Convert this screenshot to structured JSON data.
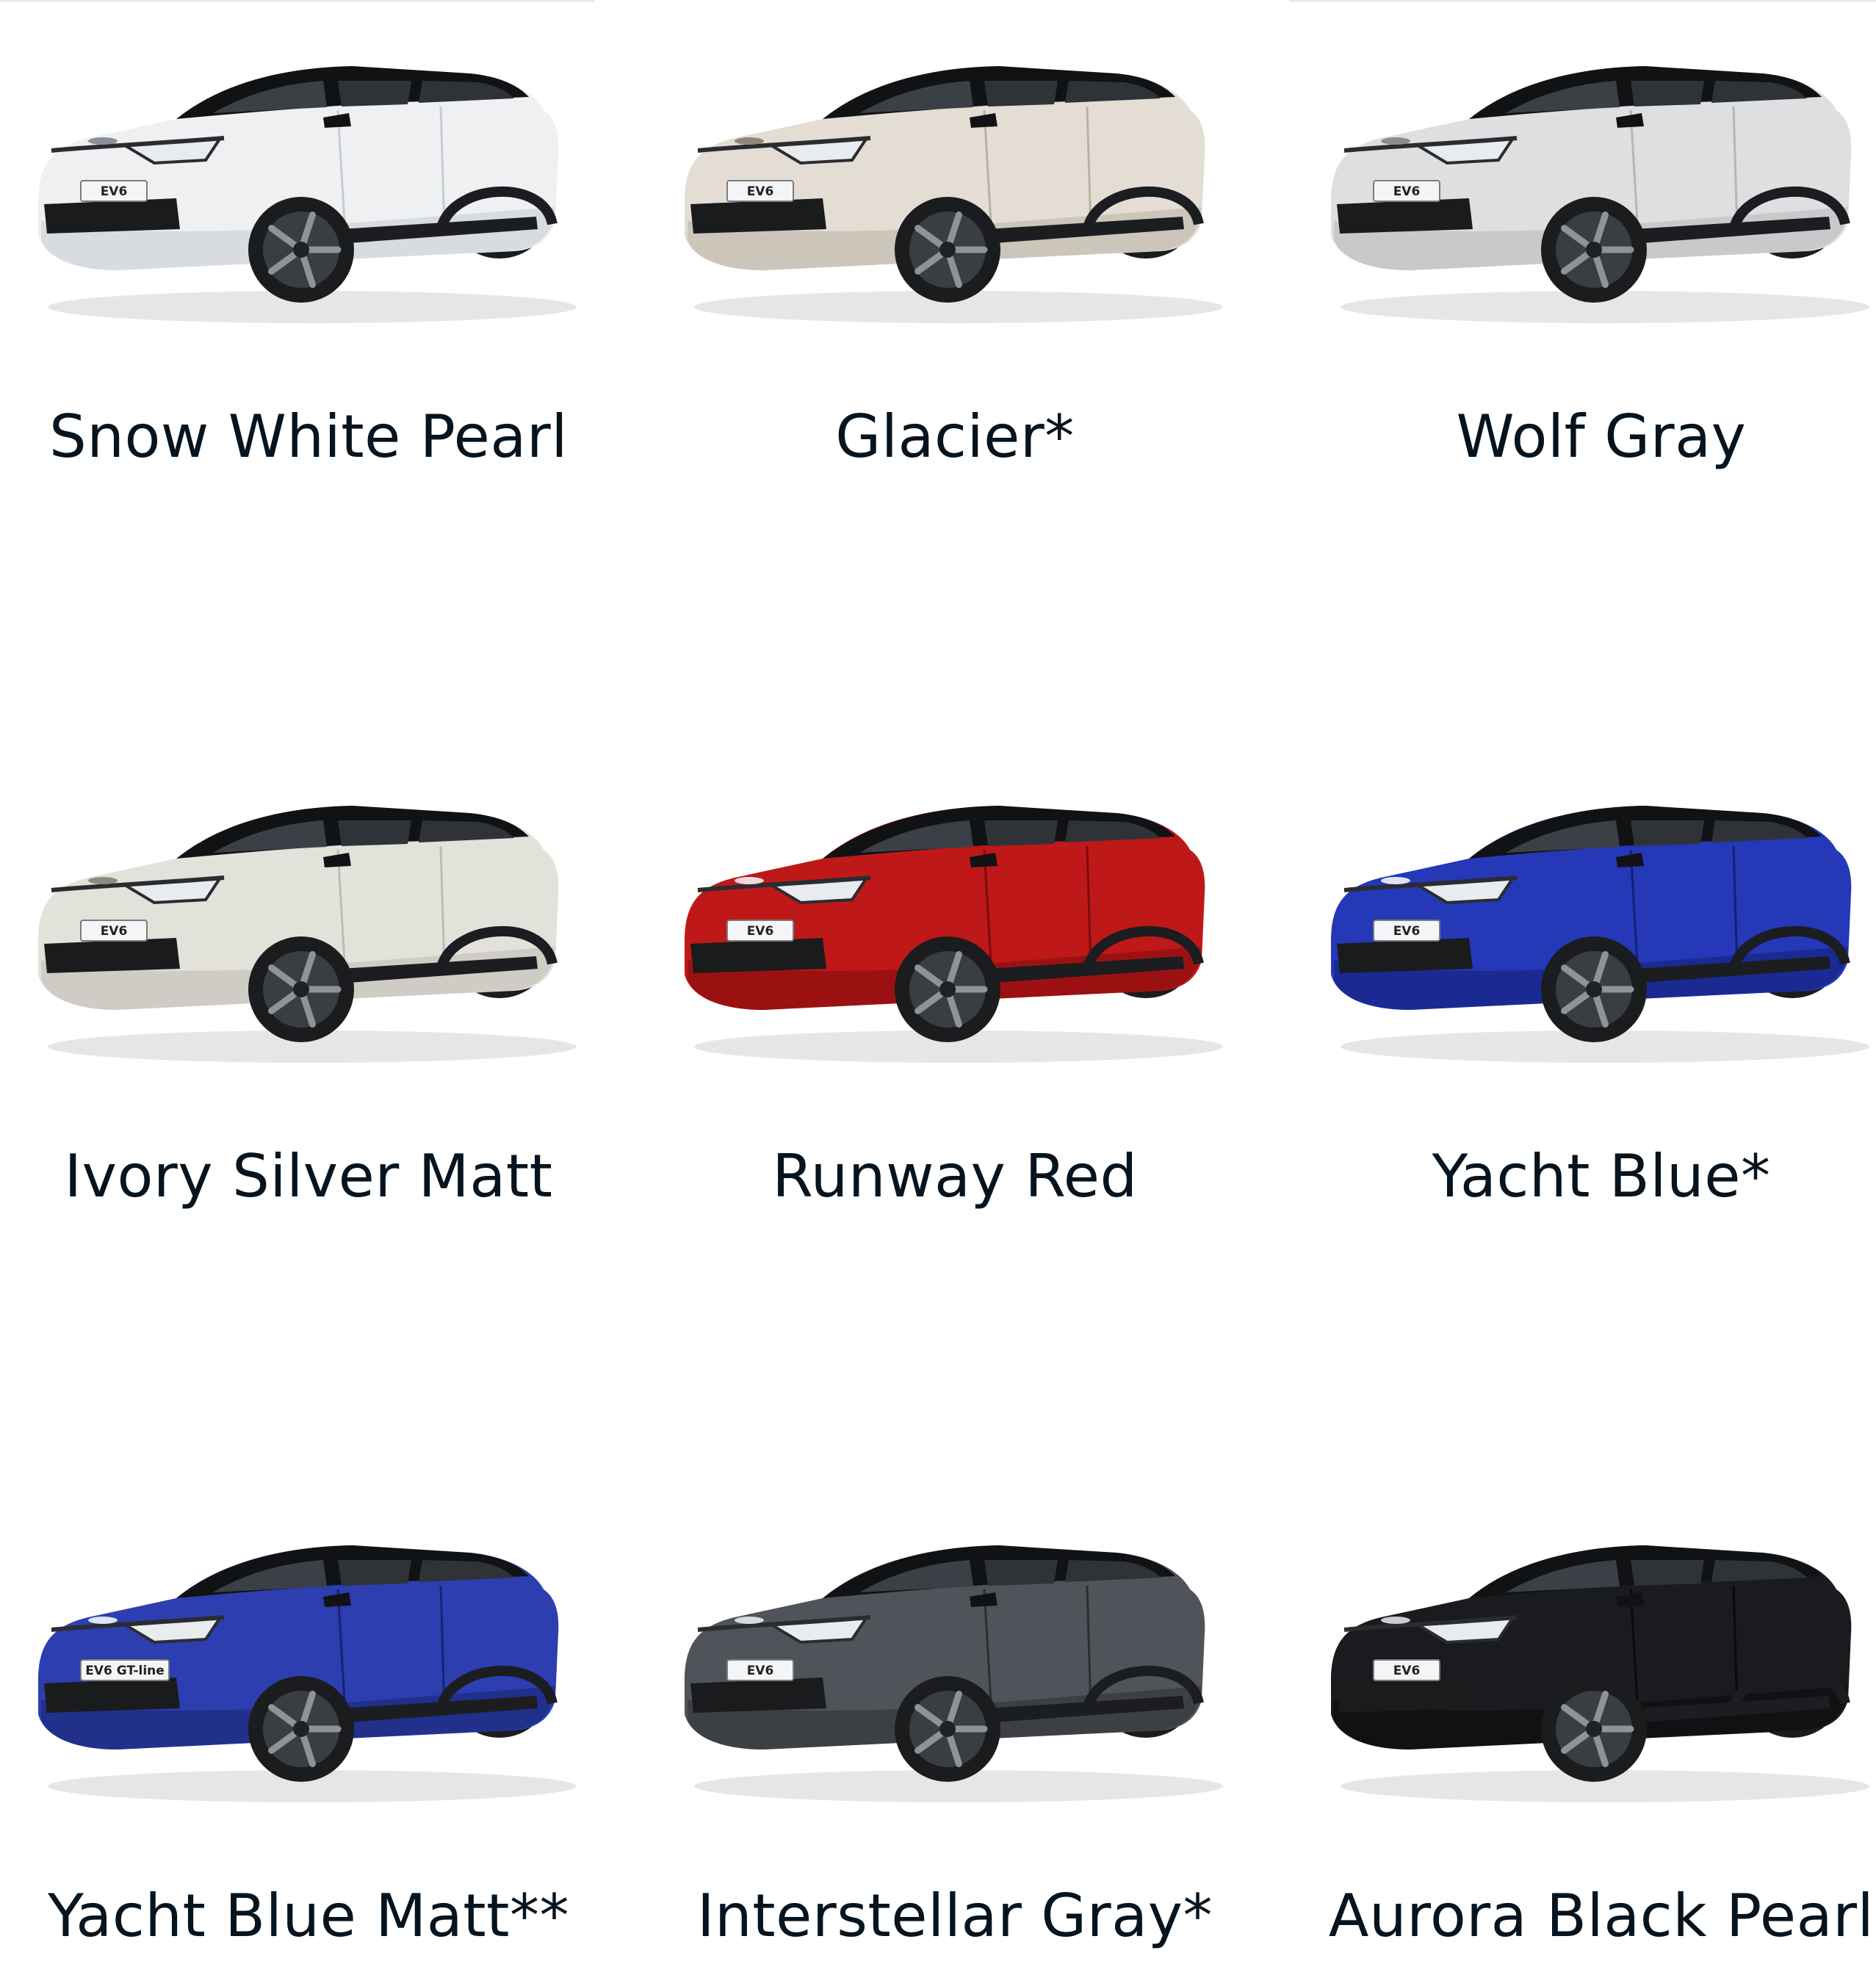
{
  "page": {
    "swatches": [
      {
        "label": "Snow White Pearl",
        "body": "#eef0f2",
        "shade": "#c7ccd1",
        "plate": "EV6",
        "logo": "#8a9096"
      },
      {
        "label": "Glacier*",
        "body": "#e3ddd3",
        "shade": "#b9b1a5",
        "plate": "EV6",
        "logo": "#8f877c"
      },
      {
        "label": "Wolf Gray",
        "body": "#dedfe0",
        "shade": "#b4b6b8",
        "plate": "EV6",
        "logo": "#8a8c8e"
      },
      {
        "label": "Ivory Silver Matt",
        "body": "#e2e1da",
        "shade": "#bdbcb3",
        "plate": "EV6",
        "logo": "#8d8c84"
      },
      {
        "label": "Runway Red",
        "body": "#bf1818",
        "shade": "#7d0c0e",
        "plate": "EV6",
        "logo": "#f0d9d9"
      },
      {
        "label": "Yacht Blue*",
        "body": "#2438b8",
        "shade": "#141f73",
        "plate": "EV6",
        "logo": "#dfe3f5"
      },
      {
        "label": "Yacht Blue Matt**",
        "body": "#2c3eb0",
        "shade": "#18246e",
        "plate": "EV6 GT-line",
        "logo": "#dfe3f5"
      },
      {
        "label": "Interstellar Gray*",
        "body": "#50545a",
        "shade": "#2b2e32",
        "plate": "EV6",
        "logo": "#d8dadc"
      },
      {
        "label": "Aurora Black Pearl",
        "body": "#1a1b1e",
        "shade": "#08090a",
        "plate": "EV6",
        "logo": "#c9cbce"
      }
    ]
  }
}
